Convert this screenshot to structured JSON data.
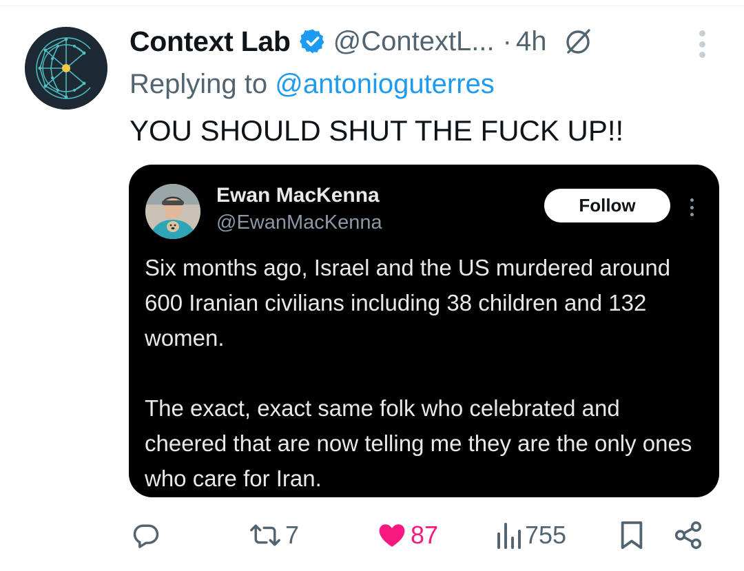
{
  "tweet": {
    "author": {
      "display_name": "Context Lab",
      "handle": "@ContextL...",
      "verified": true,
      "avatar_icon": "context-lab-logo"
    },
    "separator": "·",
    "time": "4h",
    "grok_icon": "grok-icon",
    "more_icon": "more-vertical-icon",
    "reply_prefix": "Replying to ",
    "reply_to": "@antonioguterres",
    "text": "YOU SHOULD SHUT THE FUCK UP!!"
  },
  "quoted": {
    "display_name": "Ewan MacKenna",
    "handle": "@EwanMacKenna",
    "follow_label": "Follow",
    "paragraphs": [
      "Six months ago, Israel and the US murdered around 600 Iranian civilians including 38 children and 132 women.",
      "The exact, exact same folk who celebrated and cheered that are now telling me they are the only ones who care for Iran."
    ]
  },
  "actions": {
    "reply": {
      "icon": "reply-icon",
      "count": ""
    },
    "repost": {
      "icon": "repost-icon",
      "count": "7"
    },
    "like": {
      "icon": "heart-filled-icon",
      "count": "87",
      "liked": true
    },
    "views": {
      "icon": "views-icon",
      "count": "755"
    },
    "bookmark": {
      "icon": "bookmark-icon"
    },
    "share": {
      "icon": "share-icon"
    }
  },
  "colors": {
    "accent": "#1d9bf0",
    "like": "#f91880",
    "secondary_text": "#536471",
    "quote_background": "#000000"
  }
}
